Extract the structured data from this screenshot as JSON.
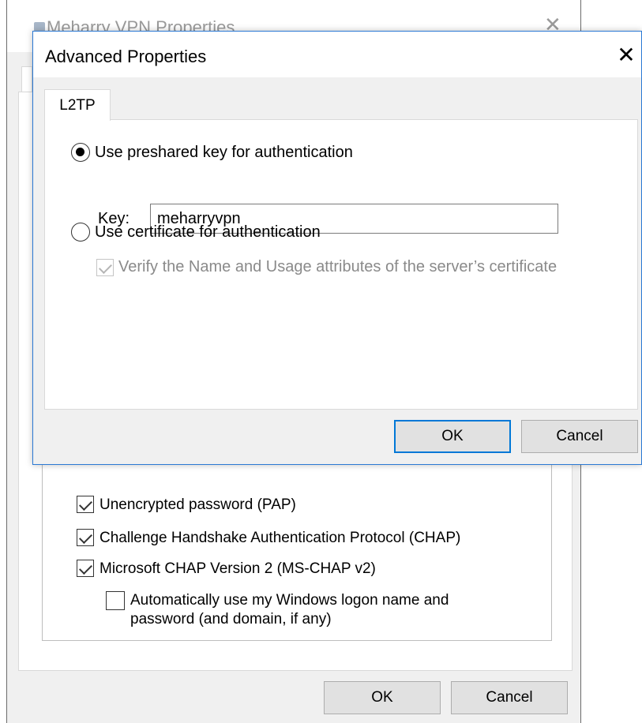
{
  "bg_window": {
    "title": "Meharry VPN Properties",
    "checkboxes": [
      {
        "label": "Unencrypted password (PAP)",
        "checked": true
      },
      {
        "label": "Challenge Handshake Authentication Protocol (CHAP)",
        "checked": true
      },
      {
        "label": "Microsoft CHAP Version 2 (MS-CHAP v2)",
        "checked": true
      }
    ],
    "auto_logon": {
      "line1": "Automatically use my Windows logon name and",
      "line2": "password (and domain, if any)",
      "checked": false
    },
    "ok_label": "OK",
    "cancel_label": "Cancel"
  },
  "adv_window": {
    "title": "Advanced Properties",
    "close_glyph": "✕",
    "tab_label": "L2TP",
    "preshared": {
      "label": "Use preshared key for authentication",
      "selected": true
    },
    "key": {
      "label": "Key:",
      "value": "meharryvpn"
    },
    "certificate": {
      "label": "Use certificate for authentication",
      "selected": false
    },
    "verify": {
      "label": "Verify the Name and Usage attributes of the server’s certificate",
      "checked": true,
      "enabled": false
    },
    "ok_label": "OK",
    "cancel_label": "Cancel"
  },
  "colors": {
    "accent": "#0078d7",
    "window_border": "#2b79d4",
    "dialog_bg": "#f0f0f0"
  }
}
